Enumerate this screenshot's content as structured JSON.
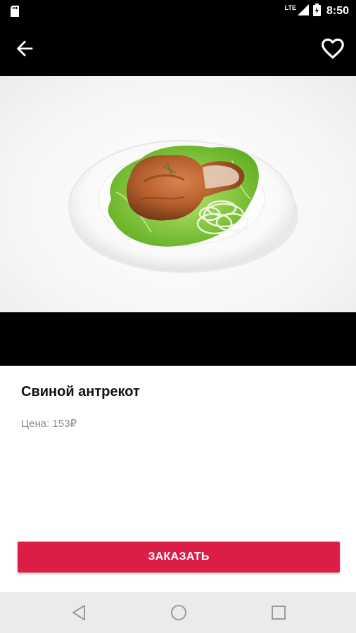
{
  "status_bar": {
    "network": "LTE",
    "time": "8:50",
    "icons": [
      "sd-card-icon",
      "lte-signal-icon",
      "battery-icon"
    ]
  },
  "toolbar": {
    "back_icon": "arrow-left-icon",
    "favorite_icon": "heart-outline-icon"
  },
  "product": {
    "image_subject": "grilled pork chop on lettuce with onion rings on a white plate",
    "title": "Свиной антрекот",
    "price_label": "Цена: 153₽"
  },
  "actions": {
    "order_label": "ЗАКАЗАТЬ"
  },
  "colors": {
    "accent": "#dc1e47",
    "toolbar": "#000000",
    "price_text": "#8a8a8a",
    "nav_bar": "#ebebeb"
  },
  "nav_bar": {
    "icons": [
      "nav-back-icon",
      "nav-home-icon",
      "nav-recents-icon"
    ]
  }
}
